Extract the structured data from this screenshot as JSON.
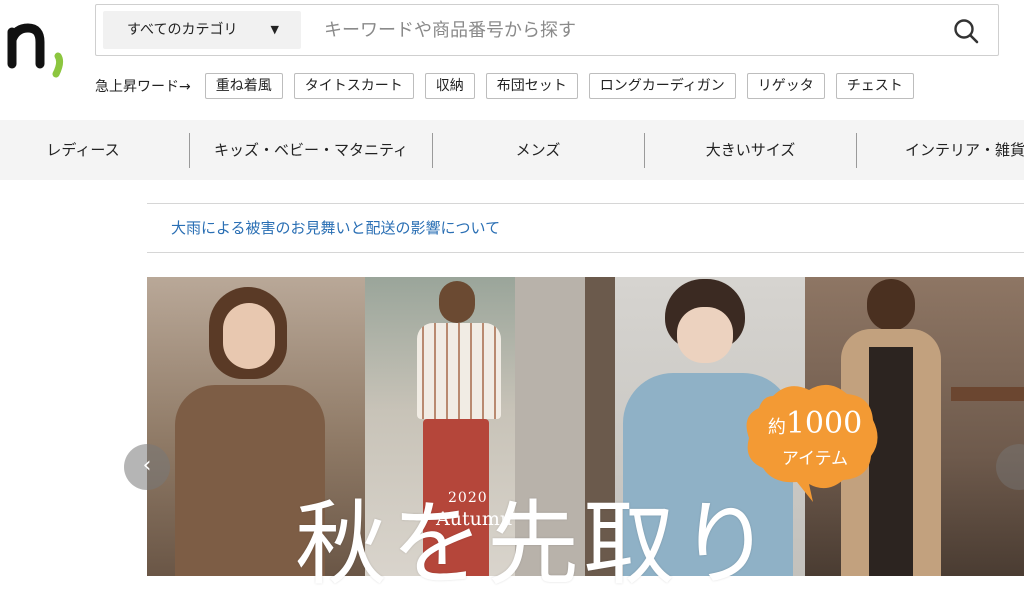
{
  "header": {
    "logo_text": "n,",
    "search": {
      "category_label": "すべてのカテゴリ",
      "placeholder": "キーワードや商品番号から探す",
      "value": ""
    }
  },
  "trending": {
    "label": "急上昇ワード→",
    "tags": [
      "重ね着風",
      "タイトスカート",
      "収納",
      "布団セット",
      "ロングカーディガン",
      "リゲッタ",
      "チェスト"
    ]
  },
  "nav": {
    "items": [
      "レディース",
      "キッズ・ベビー・マタニティ",
      "メンズ",
      "大きいサイズ",
      "インテリア・雑貨"
    ]
  },
  "notice": {
    "text": "大雨による被害のお見舞いと配送の影響について"
  },
  "banner": {
    "badge_prefix": "約",
    "badge_number": "1000",
    "badge_suffix": "アイテム",
    "year": "2020",
    "season": "Autumn",
    "headline": "秋を先取り"
  },
  "colors": {
    "notice_link": "#2a6fb4",
    "badge": "#f39a34",
    "logo": "#111111",
    "logo_accent": "#8cc63f"
  }
}
